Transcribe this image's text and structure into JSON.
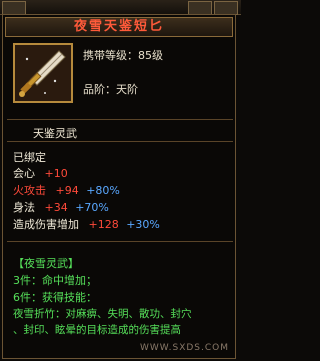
{
  "item": {
    "name": "夜雪天鉴短匕",
    "carry_level": "携带等级：85级",
    "tier": "品阶：天阶",
    "weapon_type": "天鉴灵武"
  },
  "stats": {
    "bound": "已绑定",
    "lines": [
      {
        "label": "会心",
        "base": "+10",
        "pct": ""
      },
      {
        "label": "火攻击",
        "base": "+94",
        "pct": "+80%"
      },
      {
        "label": "身法",
        "base": "+34",
        "pct": "+70%"
      },
      {
        "label": "造成伤害增加",
        "base": "+128",
        "pct": "+30%"
      }
    ]
  },
  "set": {
    "title": "【夜雪灵武】",
    "piece3": "3件：命中增加；",
    "piece6": "6件：获得技能：",
    "skill_line1": "夜雪折竹：对麻痹、失明、散功、封穴",
    "skill_line2": "、封印、眩晕的目标造成的伤害提高"
  },
  "watermark": "WWW.SXDS.COM",
  "colors": {
    "title": "#ff5a3a",
    "stat_red": "#ff4a3a",
    "stat_blue": "#5aa8ff",
    "set_green": "#56e05a"
  },
  "icon": "dagger-icon"
}
